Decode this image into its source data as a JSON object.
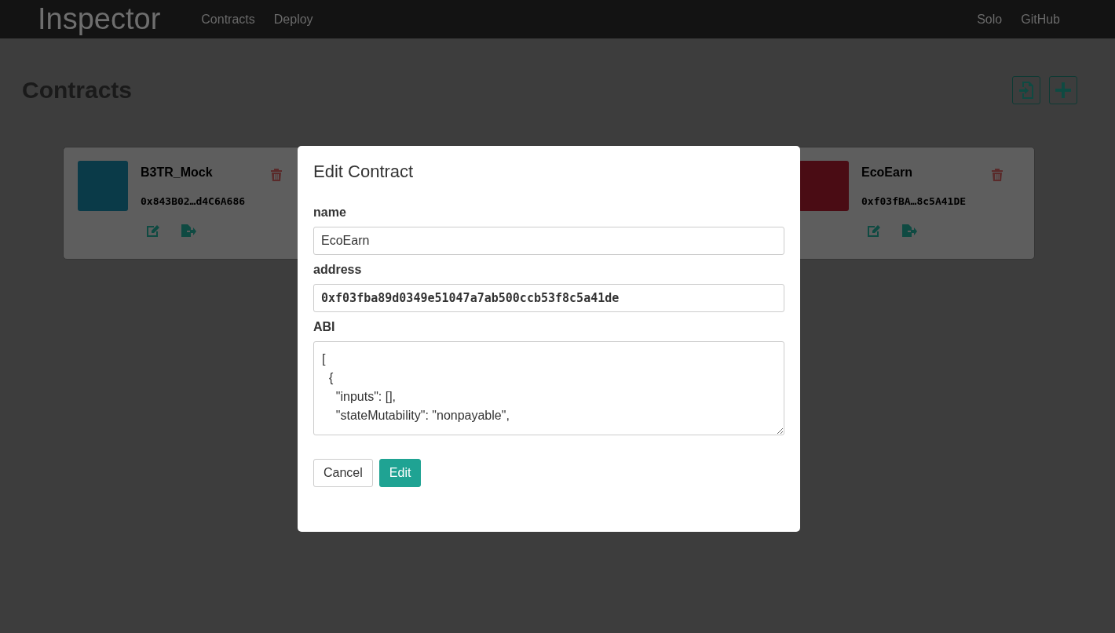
{
  "navbar": {
    "brand": "Inspector",
    "links": [
      {
        "label": "Contracts"
      },
      {
        "label": "Deploy"
      }
    ],
    "right_links": [
      {
        "label": "Solo"
      },
      {
        "label": "GitHub"
      }
    ]
  },
  "page": {
    "title": "Contracts"
  },
  "contracts": [
    {
      "name": "B3TR_Mock",
      "address": "0x843B02…d4C6A686",
      "color": "#0a3a48"
    },
    {
      "name": "EcoEarn",
      "address": "0xf03fBA…8c5A41DE",
      "color": "#4a0c14"
    }
  ],
  "modal": {
    "title": "Edit Contract",
    "fields": [
      {
        "label": "name",
        "value": "EcoEarn",
        "kind": "text"
      },
      {
        "label": "address",
        "value": "0xf03fba89d0349e51047a7ab500ccb53f8c5a41de",
        "kind": "mono"
      },
      {
        "label": "ABI",
        "value": "[\n  {\n    \"inputs\": [],\n    \"stateMutability\": \"nonpayable\",",
        "kind": "textarea"
      }
    ],
    "buttons": [
      {
        "label": "Cancel",
        "kind": "secondary"
      },
      {
        "label": "Edit",
        "kind": "primary"
      }
    ]
  }
}
